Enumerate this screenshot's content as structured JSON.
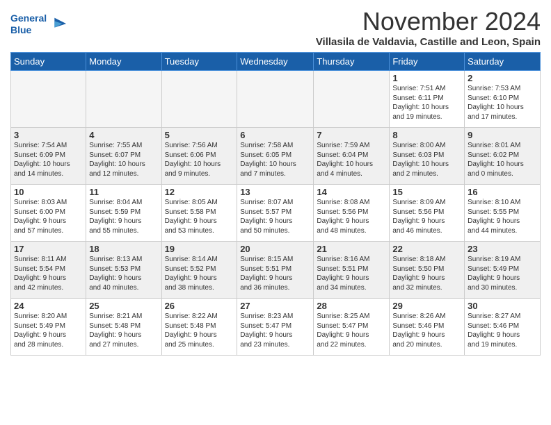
{
  "header": {
    "logo_line1": "General",
    "logo_line2": "Blue",
    "month": "November 2024",
    "location": "Villasila de Valdavia, Castille and Leon, Spain"
  },
  "weekdays": [
    "Sunday",
    "Monday",
    "Tuesday",
    "Wednesday",
    "Thursday",
    "Friday",
    "Saturday"
  ],
  "weeks": [
    {
      "shaded": false,
      "days": [
        {
          "num": "",
          "info": ""
        },
        {
          "num": "",
          "info": ""
        },
        {
          "num": "",
          "info": ""
        },
        {
          "num": "",
          "info": ""
        },
        {
          "num": "",
          "info": ""
        },
        {
          "num": "1",
          "info": "Sunrise: 7:51 AM\nSunset: 6:11 PM\nDaylight: 10 hours\nand 19 minutes."
        },
        {
          "num": "2",
          "info": "Sunrise: 7:53 AM\nSunset: 6:10 PM\nDaylight: 10 hours\nand 17 minutes."
        }
      ]
    },
    {
      "shaded": true,
      "days": [
        {
          "num": "3",
          "info": "Sunrise: 7:54 AM\nSunset: 6:09 PM\nDaylight: 10 hours\nand 14 minutes."
        },
        {
          "num": "4",
          "info": "Sunrise: 7:55 AM\nSunset: 6:07 PM\nDaylight: 10 hours\nand 12 minutes."
        },
        {
          "num": "5",
          "info": "Sunrise: 7:56 AM\nSunset: 6:06 PM\nDaylight: 10 hours\nand 9 minutes."
        },
        {
          "num": "6",
          "info": "Sunrise: 7:58 AM\nSunset: 6:05 PM\nDaylight: 10 hours\nand 7 minutes."
        },
        {
          "num": "7",
          "info": "Sunrise: 7:59 AM\nSunset: 6:04 PM\nDaylight: 10 hours\nand 4 minutes."
        },
        {
          "num": "8",
          "info": "Sunrise: 8:00 AM\nSunset: 6:03 PM\nDaylight: 10 hours\nand 2 minutes."
        },
        {
          "num": "9",
          "info": "Sunrise: 8:01 AM\nSunset: 6:02 PM\nDaylight: 10 hours\nand 0 minutes."
        }
      ]
    },
    {
      "shaded": false,
      "days": [
        {
          "num": "10",
          "info": "Sunrise: 8:03 AM\nSunset: 6:00 PM\nDaylight: 9 hours\nand 57 minutes."
        },
        {
          "num": "11",
          "info": "Sunrise: 8:04 AM\nSunset: 5:59 PM\nDaylight: 9 hours\nand 55 minutes."
        },
        {
          "num": "12",
          "info": "Sunrise: 8:05 AM\nSunset: 5:58 PM\nDaylight: 9 hours\nand 53 minutes."
        },
        {
          "num": "13",
          "info": "Sunrise: 8:07 AM\nSunset: 5:57 PM\nDaylight: 9 hours\nand 50 minutes."
        },
        {
          "num": "14",
          "info": "Sunrise: 8:08 AM\nSunset: 5:56 PM\nDaylight: 9 hours\nand 48 minutes."
        },
        {
          "num": "15",
          "info": "Sunrise: 8:09 AM\nSunset: 5:56 PM\nDaylight: 9 hours\nand 46 minutes."
        },
        {
          "num": "16",
          "info": "Sunrise: 8:10 AM\nSunset: 5:55 PM\nDaylight: 9 hours\nand 44 minutes."
        }
      ]
    },
    {
      "shaded": true,
      "days": [
        {
          "num": "17",
          "info": "Sunrise: 8:11 AM\nSunset: 5:54 PM\nDaylight: 9 hours\nand 42 minutes."
        },
        {
          "num": "18",
          "info": "Sunrise: 8:13 AM\nSunset: 5:53 PM\nDaylight: 9 hours\nand 40 minutes."
        },
        {
          "num": "19",
          "info": "Sunrise: 8:14 AM\nSunset: 5:52 PM\nDaylight: 9 hours\nand 38 minutes."
        },
        {
          "num": "20",
          "info": "Sunrise: 8:15 AM\nSunset: 5:51 PM\nDaylight: 9 hours\nand 36 minutes."
        },
        {
          "num": "21",
          "info": "Sunrise: 8:16 AM\nSunset: 5:51 PM\nDaylight: 9 hours\nand 34 minutes."
        },
        {
          "num": "22",
          "info": "Sunrise: 8:18 AM\nSunset: 5:50 PM\nDaylight: 9 hours\nand 32 minutes."
        },
        {
          "num": "23",
          "info": "Sunrise: 8:19 AM\nSunset: 5:49 PM\nDaylight: 9 hours\nand 30 minutes."
        }
      ]
    },
    {
      "shaded": false,
      "days": [
        {
          "num": "24",
          "info": "Sunrise: 8:20 AM\nSunset: 5:49 PM\nDaylight: 9 hours\nand 28 minutes."
        },
        {
          "num": "25",
          "info": "Sunrise: 8:21 AM\nSunset: 5:48 PM\nDaylight: 9 hours\nand 27 minutes."
        },
        {
          "num": "26",
          "info": "Sunrise: 8:22 AM\nSunset: 5:48 PM\nDaylight: 9 hours\nand 25 minutes."
        },
        {
          "num": "27",
          "info": "Sunrise: 8:23 AM\nSunset: 5:47 PM\nDaylight: 9 hours\nand 23 minutes."
        },
        {
          "num": "28",
          "info": "Sunrise: 8:25 AM\nSunset: 5:47 PM\nDaylight: 9 hours\nand 22 minutes."
        },
        {
          "num": "29",
          "info": "Sunrise: 8:26 AM\nSunset: 5:46 PM\nDaylight: 9 hours\nand 20 minutes."
        },
        {
          "num": "30",
          "info": "Sunrise: 8:27 AM\nSunset: 5:46 PM\nDaylight: 9 hours\nand 19 minutes."
        }
      ]
    }
  ]
}
